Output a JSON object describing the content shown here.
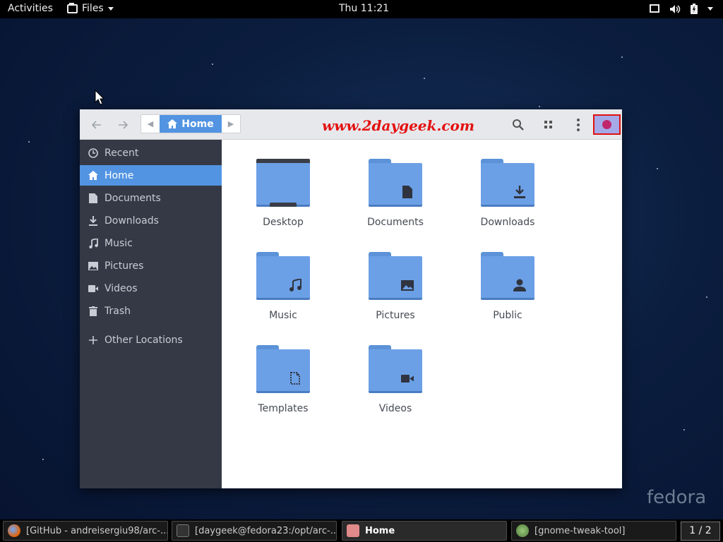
{
  "topbar": {
    "activities": "Activities",
    "app_menu": "Files",
    "clock": "Thu 11:21",
    "tray_icons": [
      "screen-icon",
      "volume-icon",
      "battery-icon",
      "system-menu-arrow"
    ]
  },
  "header": {
    "back": "back-arrow",
    "forward": "forward-arrow",
    "breadcrumb": "Home",
    "watermark": "www.2daygeek.com",
    "buttons": [
      "search-icon",
      "grid-icon",
      "menu-icon"
    ]
  },
  "sidebar": {
    "items": [
      {
        "label": "Recent",
        "icon": "clock-icon"
      },
      {
        "label": "Home",
        "icon": "home-icon"
      },
      {
        "label": "Documents",
        "icon": "document-icon"
      },
      {
        "label": "Downloads",
        "icon": "download-icon"
      },
      {
        "label": "Music",
        "icon": "music-icon"
      },
      {
        "label": "Pictures",
        "icon": "picture-icon"
      },
      {
        "label": "Videos",
        "icon": "video-icon"
      },
      {
        "label": "Trash",
        "icon": "trash-icon"
      },
      {
        "label": "Other Locations",
        "icon": "plus-icon"
      }
    ],
    "active": "Home"
  },
  "folders": [
    {
      "label": "Desktop",
      "icon": "desktop-folder-icon"
    },
    {
      "label": "Documents",
      "icon": "documents-folder-icon"
    },
    {
      "label": "Downloads",
      "icon": "downloads-folder-icon"
    },
    {
      "label": "Music",
      "icon": "music-folder-icon"
    },
    {
      "label": "Pictures",
      "icon": "pictures-folder-icon"
    },
    {
      "label": "Public",
      "icon": "public-folder-icon"
    },
    {
      "label": "Templates",
      "icon": "templates-folder-icon"
    },
    {
      "label": "Videos",
      "icon": "videos-folder-icon"
    }
  ],
  "taskbar": {
    "tasks": [
      {
        "label": "[GitHub - andreisergiu98/arc-..."
      },
      {
        "label": "[daygeek@fedora23:/opt/arc-..."
      },
      {
        "label": "Home"
      },
      {
        "label": "[gnome-tweak-tool]"
      }
    ],
    "workspace": "1 / 2"
  },
  "branding": "fedora",
  "colors": {
    "accent": "#5294e2",
    "sidebar_bg": "#353945",
    "folder": "#6ca0e6",
    "watermark": "#e41111"
  }
}
